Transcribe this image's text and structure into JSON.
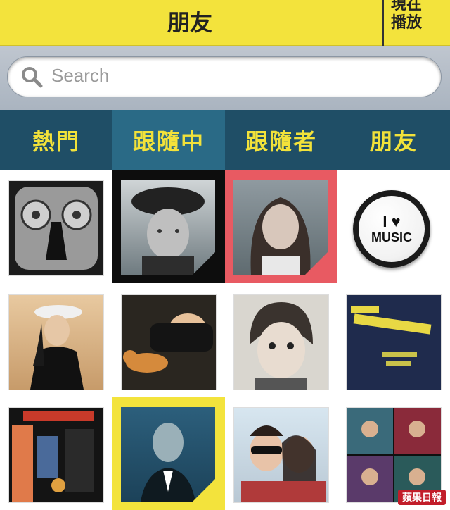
{
  "header": {
    "title": "朋友",
    "now_playing_line1": "現在",
    "now_playing_line2": "播放"
  },
  "search": {
    "placeholder": "Search"
  },
  "tabs": [
    {
      "label": "熱門",
      "active": false
    },
    {
      "label": "跟隨中",
      "active": true
    },
    {
      "label": "跟隨者",
      "active": false
    },
    {
      "label": "朋友",
      "active": false
    }
  ],
  "grid": {
    "music_badge_line1": "I ♥",
    "music_badge_line2": "MUSIC"
  },
  "watermark": "蘋果日報",
  "colors": {
    "header_bg": "#f3e33c",
    "tab_bg": "#1f4e66",
    "tab_active_bg": "#2a6a86",
    "tab_text": "#f2e23a",
    "highlight_pink": "#e85a62"
  }
}
